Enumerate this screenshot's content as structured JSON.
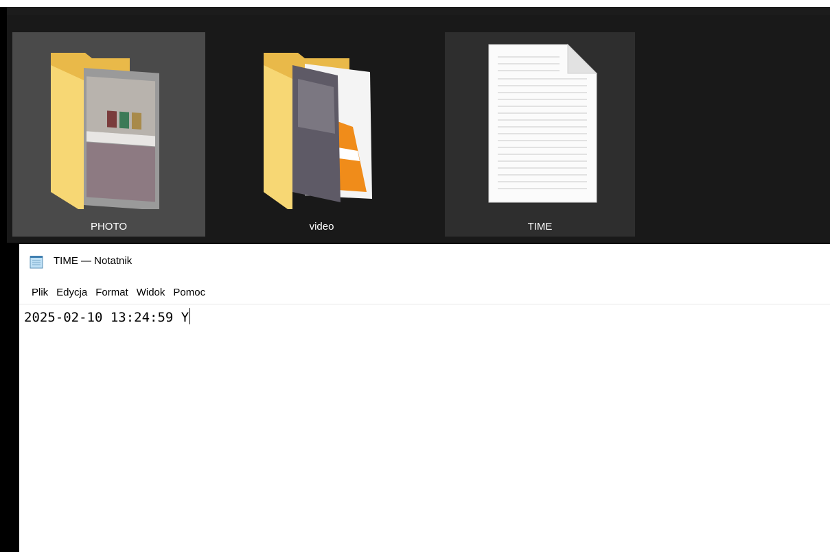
{
  "explorer": {
    "items": [
      {
        "name": "PHOTO",
        "type": "folder",
        "state": "selected"
      },
      {
        "name": "video",
        "type": "folder",
        "state": "normal"
      },
      {
        "name": "TIME",
        "type": "text-file",
        "state": "hover"
      }
    ]
  },
  "notepad": {
    "title": "TIME — Notatnik",
    "icon": "notepad-icon",
    "menu": [
      "Plik",
      "Edycja",
      "Format",
      "Widok",
      "Pomoc"
    ],
    "content": "2025-02-10 13:24:59 Y"
  },
  "colors": {
    "explorer_bg": "#191919",
    "selected_tile": "#4a4a4a",
    "hover_tile": "#2e2e2e",
    "folder": "#f7d774"
  }
}
